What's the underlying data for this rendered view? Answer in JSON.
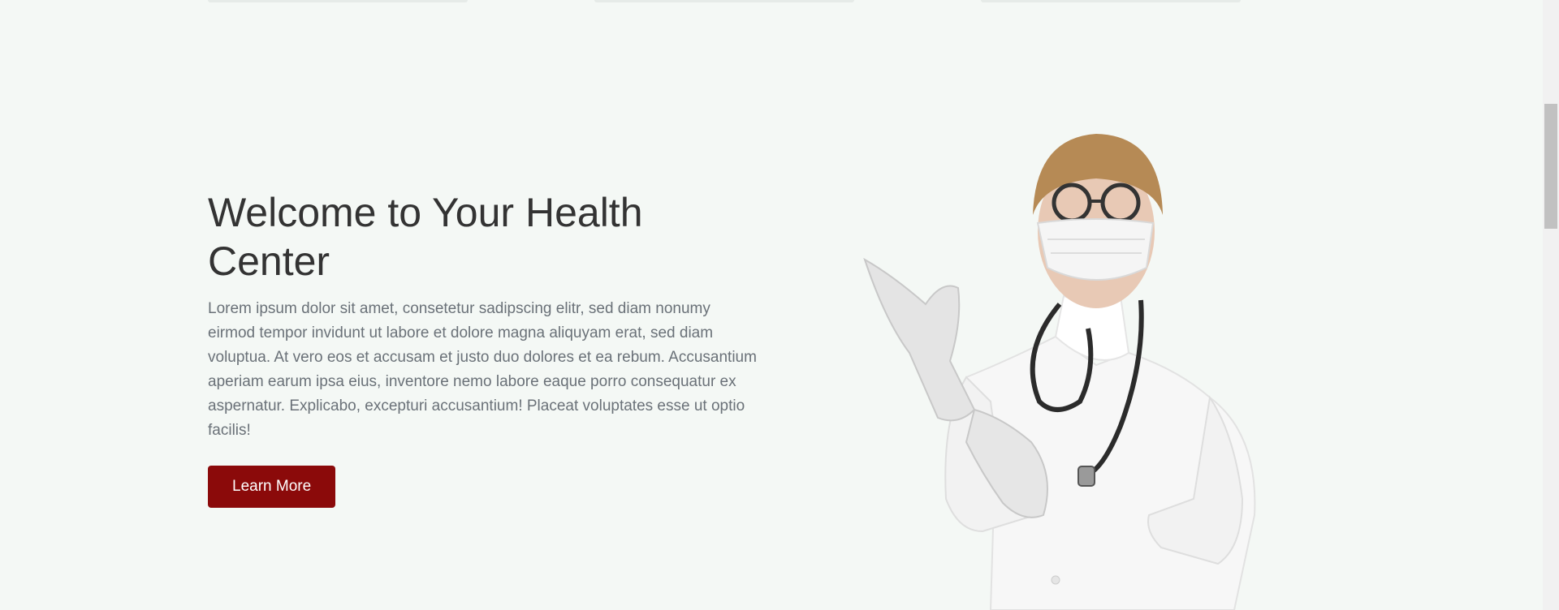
{
  "hero": {
    "title": "Welcome to Your Health Center",
    "description": "Lorem ipsum dolor sit amet, consetetur sadipscing elitr, sed diam nonumy eirmod tempor invidunt ut labore et dolore magna aliquyam erat, sed diam voluptua. At vero eos et accusam et justo duo dolores et ea rebum. Accusantium aperiam earum ipsa eius, inventore nemo labore eaque porro consequatur ex aspernatur. Explicabo, excepturi accusantium! Placeat voluptates esse ut optio facilis!",
    "button_label": "Learn More",
    "image_alt": "doctor-wearing-mask-and-gloves"
  },
  "colors": {
    "background": "#f4f8f5",
    "accent": "#8b0a0a",
    "title": "#333333",
    "body_text": "#6a7178"
  }
}
